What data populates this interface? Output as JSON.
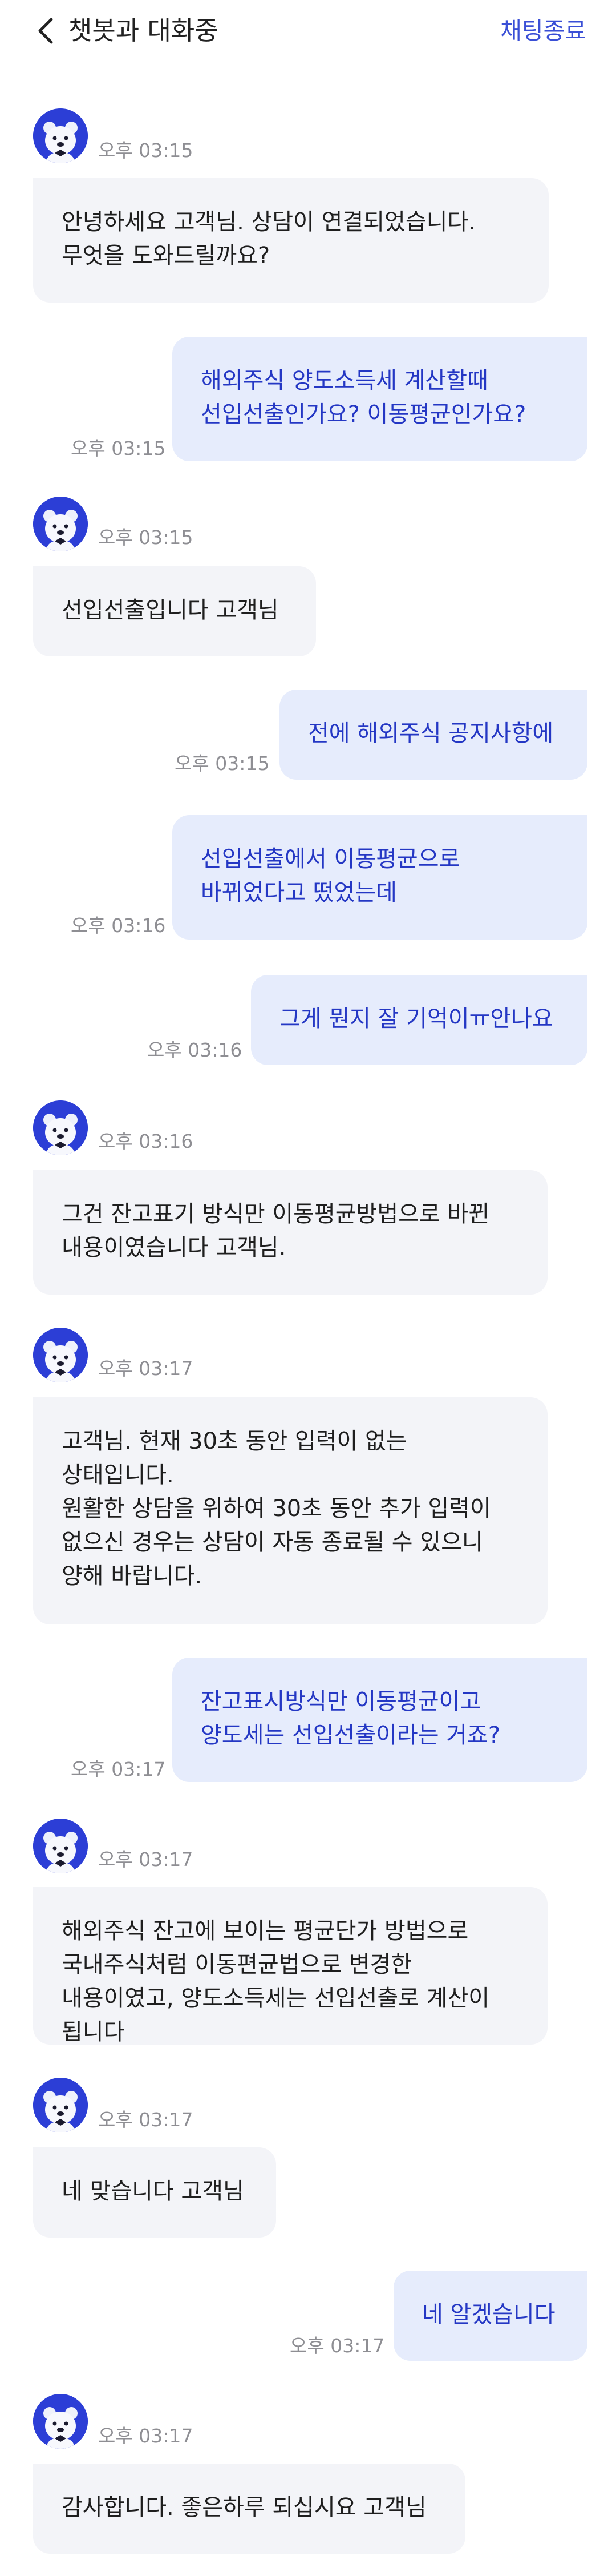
{
  "header": {
    "title": "챗봇과 대화중",
    "end_chat_label": "채팅종료"
  },
  "colors": {
    "accent": "#3a4fd6",
    "user_bubble": "#e6ecfc",
    "user_text": "#2437c4",
    "bot_bubble": "#f3f4f8",
    "timestamp": "#8e8e93"
  },
  "messages": [
    {
      "sender": "bot",
      "time": "오후 03:15",
      "text": "안녕하세요 고객님. 상담이 연결되었습니다. 무엇을 도와드릴까요?"
    },
    {
      "sender": "user",
      "time": "오후 03:15",
      "text": "해외주식 양도소득세 계산할때 선입선출인가요? 이동평균인가요?"
    },
    {
      "sender": "bot",
      "time": "오후 03:15",
      "text": "선입선출입니다 고객님"
    },
    {
      "sender": "user",
      "time": "오후 03:15",
      "text": "전에 해외주식 공지사항에"
    },
    {
      "sender": "user",
      "time": "오후 03:16",
      "text": "선입선출에서 이동평균으로 바뀌었다고 떴었는데"
    },
    {
      "sender": "user",
      "time": "오후 03:16",
      "text": "그게 뭔지 잘 기억이ㅠ안나요"
    },
    {
      "sender": "bot",
      "time": "오후 03:16",
      "text": "그건 잔고표기 방식만 이동평균방법으로 바뀐 내용이였습니다 고객님."
    },
    {
      "sender": "bot",
      "time": "오후 03:17",
      "text": "고객님. 현재 30초 동안 입력이 없는 상태입니다.\n원활한 상담을 위하여 30초 동안 추가 입력이 없으신 경우는 상담이 자동 종료될 수 있으니 양해 바랍니다."
    },
    {
      "sender": "user",
      "time": "오후 03:17",
      "text": "잔고표시방식만 이동평균이고 양도세는 선입선출이라는 거죠?"
    },
    {
      "sender": "bot",
      "time": "오후 03:17",
      "text": "해외주식 잔고에 보이는 평균단가 방법으로 국내주식처럼 이동편균법으로 변경한 내용이였고, 양도소득세는 선입선출로 계산이 됩니다"
    },
    {
      "sender": "bot",
      "time": "오후 03:17",
      "text": "네 맞습니다 고객님"
    },
    {
      "sender": "user",
      "time": "오후 03:17",
      "text": "네 알겠습니다"
    },
    {
      "sender": "bot",
      "time": "오후 03:17",
      "text": "감사합니다. 좋은하루 되십시요 고객님"
    }
  ]
}
